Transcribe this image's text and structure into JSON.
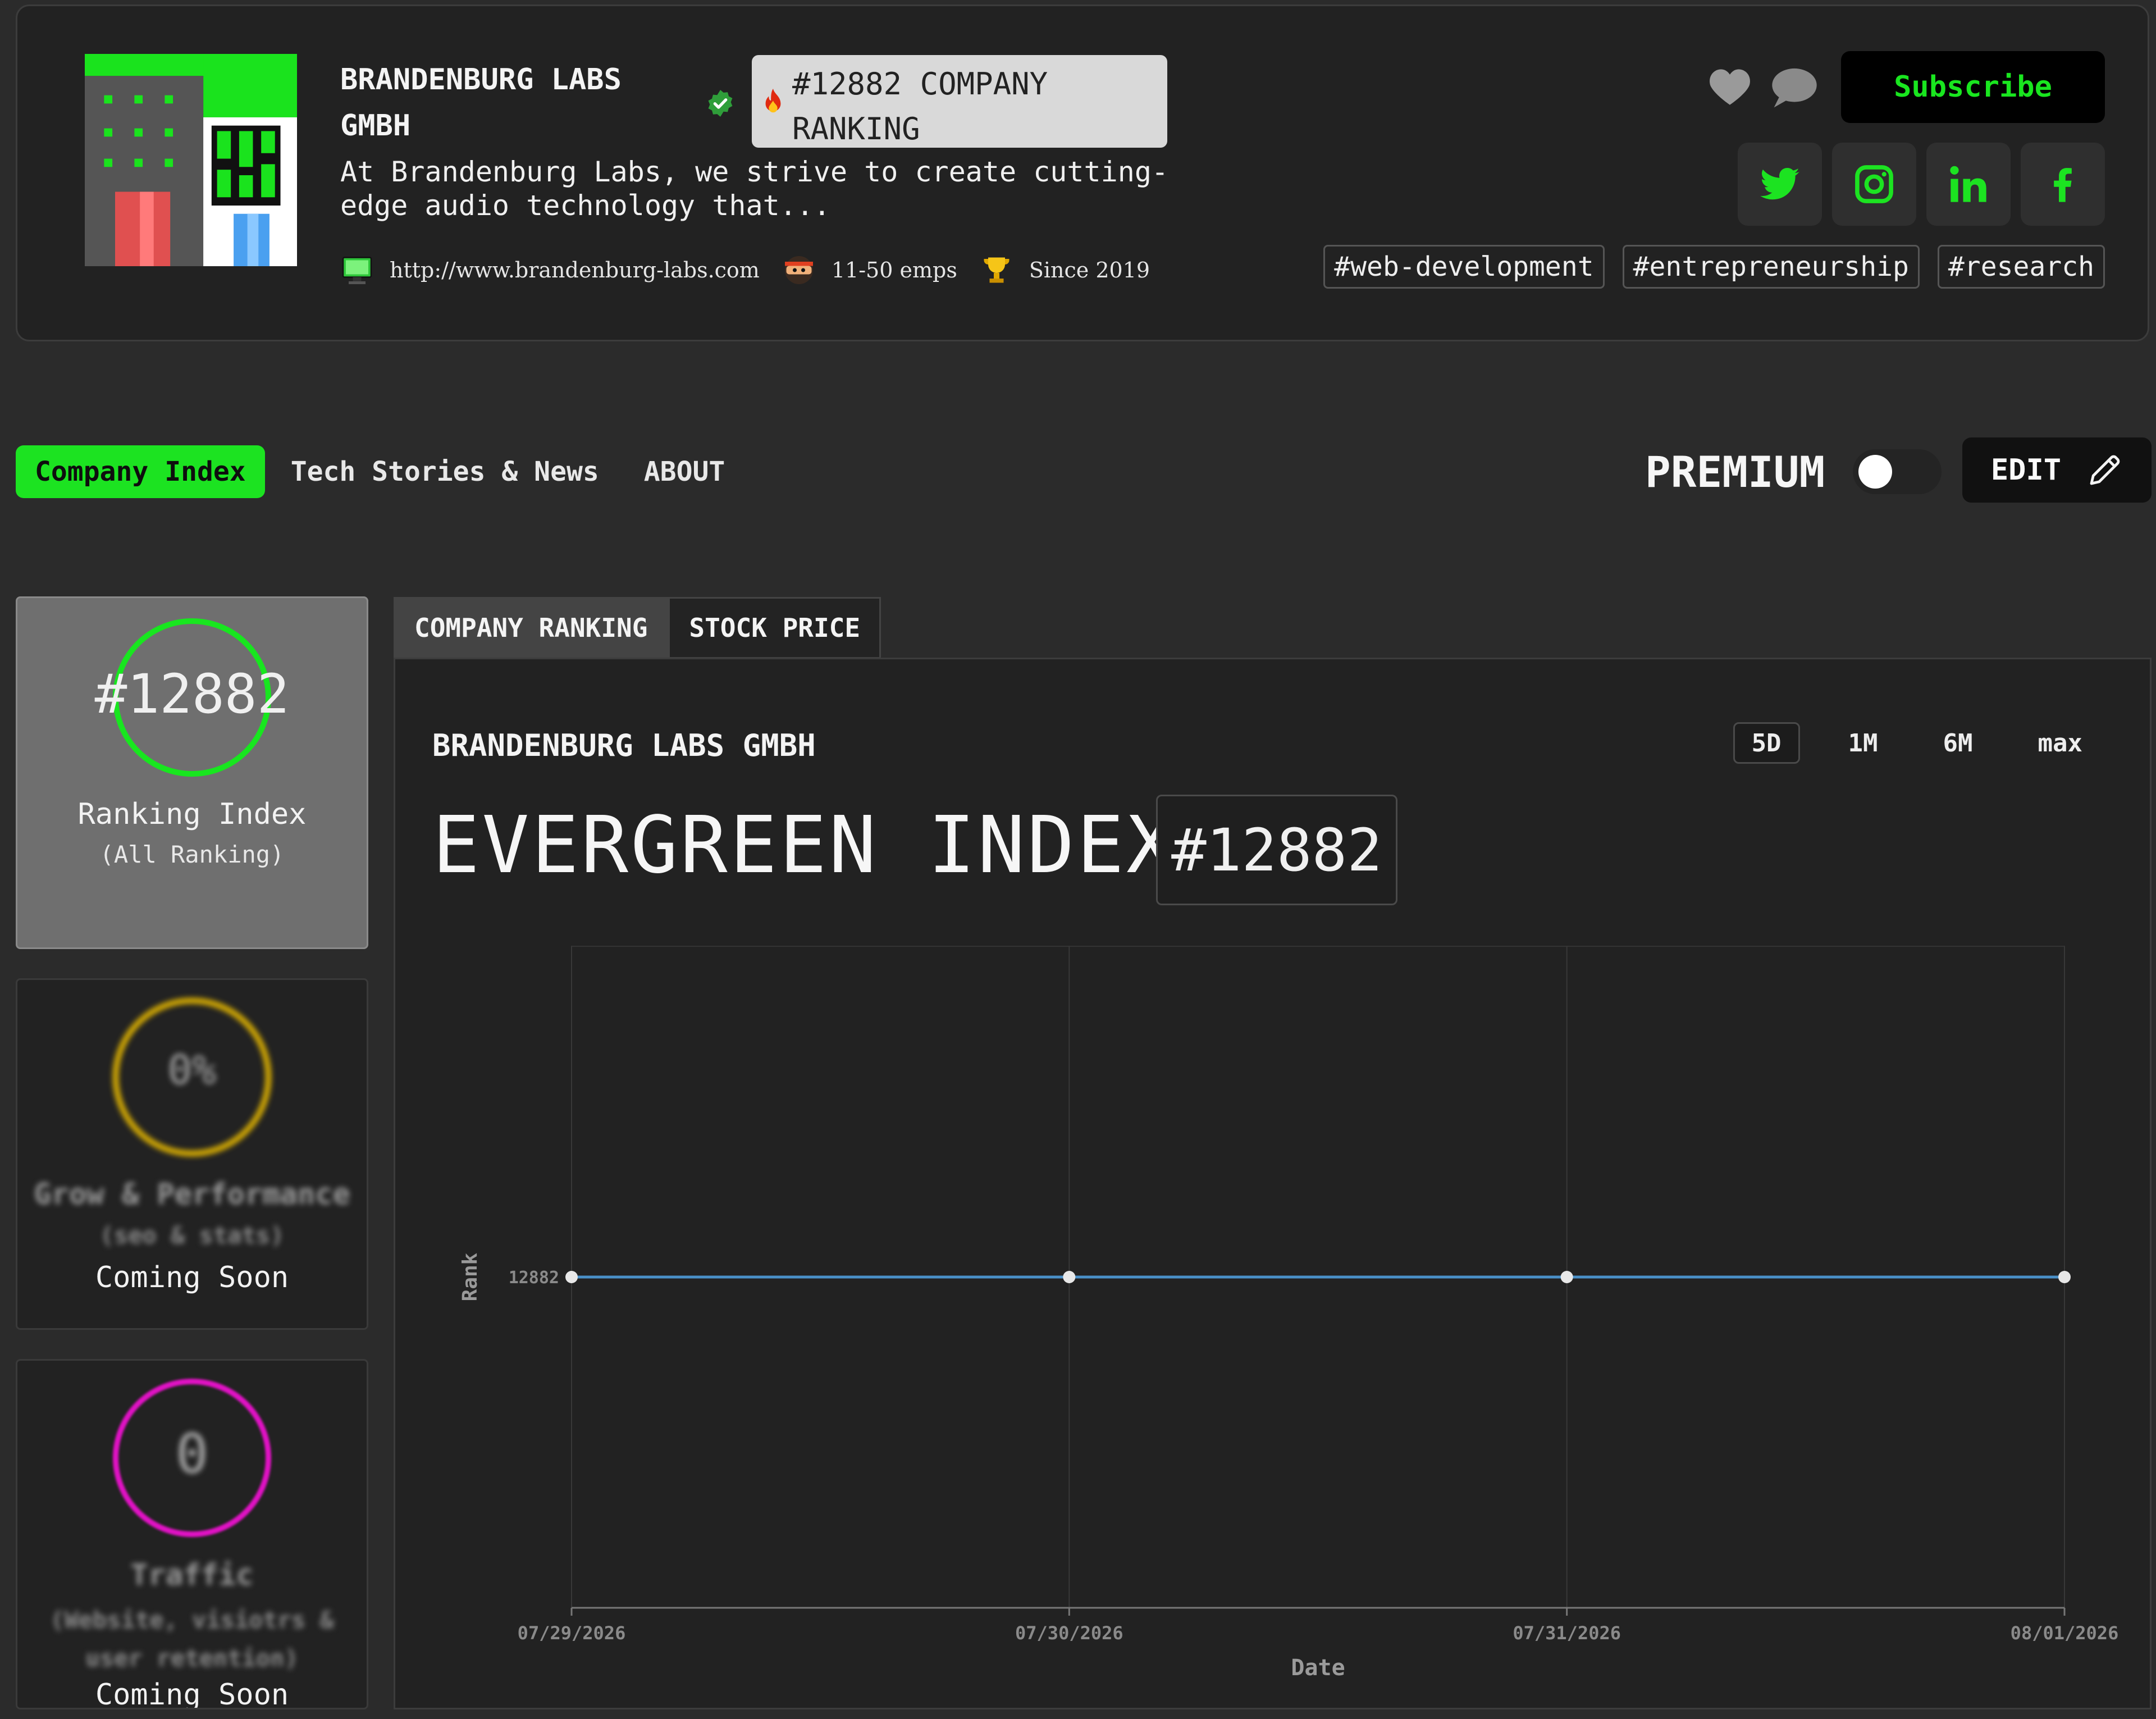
{
  "header": {
    "company_name": "BRANDENBURG LABS GMBH",
    "rank_badge": "#12882 COMPANY RANKING",
    "description": "At Brandenburg Labs, we strive to create cutting-edge audio technology that...",
    "website": "http://www.brandenburg-labs.com",
    "employees": "11-50 emps",
    "since": "Since 2019",
    "subscribe_label": "Subscribe",
    "socials": [
      "twitter-icon",
      "instagram-icon",
      "linkedin-icon",
      "facebook-icon"
    ],
    "tags": [
      "#web-development",
      "#entrepreneurship",
      "#research"
    ]
  },
  "nav": {
    "tabs": [
      {
        "label": "Company Index",
        "active": true
      },
      {
        "label": "Tech Stories & News",
        "active": false
      },
      {
        "label": "ABOUT",
        "active": false
      }
    ],
    "premium_label": "PREMIUM",
    "premium_enabled": false,
    "edit_label": "EDIT"
  },
  "stats": {
    "ranking": {
      "value": "#12882",
      "label": "Ranking Index",
      "sub": "(All Ranking)"
    },
    "grow": {
      "value": "0%",
      "label": "Grow & Performance",
      "sub": "(seo & stats)",
      "status": "Coming Soon"
    },
    "traffic": {
      "value": "0",
      "label": "Traffic",
      "sub": "(Website, visiotrs & user retention)",
      "status": "Coming Soon"
    }
  },
  "chart_panel": {
    "tabs": [
      {
        "label": "COMPANY RANKING",
        "active": true
      },
      {
        "label": "STOCK PRICE",
        "active": false
      }
    ],
    "title": "BRANDENBURG LABS GMBH",
    "ranges": [
      {
        "label": "5D",
        "active": true
      },
      {
        "label": "1M",
        "active": false
      },
      {
        "label": "6M",
        "active": false
      },
      {
        "label": "max",
        "active": false
      }
    ],
    "index_label": "EVERGREEN INDEX",
    "index_rank": "#12882"
  },
  "colors": {
    "accent_green": "#1ce321",
    "ring_gold": "#e6b800",
    "ring_magenta": "#e012c4",
    "line_blue": "#4a90c8"
  },
  "chart_data": {
    "type": "line",
    "xlabel": "Date",
    "ylabel": "Rank",
    "x": [
      "07/29/2026",
      "07/30/2026",
      "07/31/2026",
      "08/01/2026"
    ],
    "series": [
      {
        "values": [
          12882,
          12882,
          12882,
          12882
        ]
      }
    ],
    "y_ticks": [
      12882
    ],
    "grid": true
  }
}
